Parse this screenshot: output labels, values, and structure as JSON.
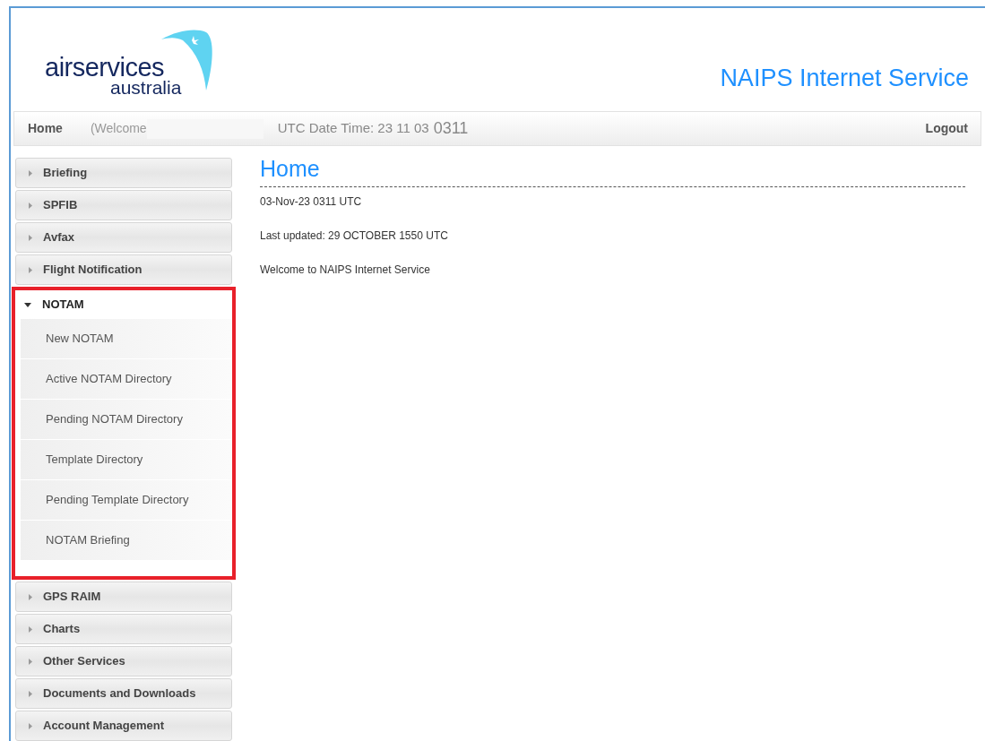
{
  "logo": {
    "line_1": "airservices",
    "line_2": "australia"
  },
  "site_title": "NAIPS Internet Service",
  "nav": {
    "home": "Home",
    "welcome": "(Welcome",
    "utc_label": "UTC Date Time: 23 11 03",
    "utc_time": "0311",
    "logout": "Logout"
  },
  "sidebar": {
    "items": [
      {
        "label": "Briefing",
        "expanded": false
      },
      {
        "label": "SPFIB",
        "expanded": false
      },
      {
        "label": "Avfax",
        "expanded": false
      },
      {
        "label": "Flight Notification",
        "expanded": false
      },
      {
        "label": "NOTAM",
        "expanded": true,
        "highlighted": true,
        "children": [
          {
            "label": "New NOTAM"
          },
          {
            "label": "Active NOTAM Directory"
          },
          {
            "label": "Pending NOTAM Directory"
          },
          {
            "label": "Template Directory"
          },
          {
            "label": "Pending Template Directory"
          },
          {
            "label": "NOTAM Briefing"
          }
        ]
      },
      {
        "label": "GPS RAIM",
        "expanded": false
      },
      {
        "label": "Charts",
        "expanded": false
      },
      {
        "label": "Other Services",
        "expanded": false
      },
      {
        "label": "Documents and Downloads",
        "expanded": false
      },
      {
        "label": "Account Management",
        "expanded": false
      }
    ]
  },
  "main": {
    "heading": "Home",
    "lines": [
      "03-Nov-23 0311 UTC",
      "Last updated: 29 OCTOBER 1550 UTC",
      "Welcome to NAIPS Internet Service"
    ]
  }
}
